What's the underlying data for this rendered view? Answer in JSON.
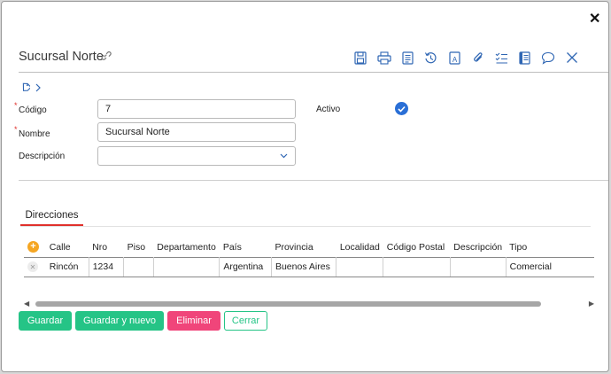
{
  "header": {
    "title": "Sucursal Norte"
  },
  "colors": {
    "accent": "#2f66b3",
    "primary_button": "#25c486",
    "danger_button": "#f0457a",
    "tab_underline": "#e0302b"
  },
  "toolbar_icons": [
    "save-icon",
    "print-icon",
    "document-icon",
    "history-icon",
    "translate-icon",
    "attachment-icon",
    "checklist-icon",
    "notes-icon",
    "comment-icon",
    "close-icon"
  ],
  "form": {
    "codigo": {
      "label": "Código",
      "value": "7"
    },
    "nombre": {
      "label": "Nombre",
      "value": "Sucursal Norte"
    },
    "descripcion": {
      "label": "Descripción",
      "value": ""
    },
    "activo": {
      "label": "Activo",
      "checked": true
    }
  },
  "tabs": [
    {
      "label": "Direcciones"
    }
  ],
  "table": {
    "columns": [
      "Calle",
      "Nro",
      "Piso",
      "Departamento",
      "País",
      "Provincia",
      "Localidad",
      "Código Postal",
      "Descripción",
      "Tipo"
    ],
    "rows": [
      {
        "calle": "Rincón",
        "nro": "1234",
        "piso": "",
        "departamento": "",
        "pais": "Argentina",
        "provincia": "Buenos Aires",
        "localidad": "",
        "codigo_postal": "",
        "descripcion": "",
        "tipo": "Comercial"
      }
    ]
  },
  "buttons": {
    "save": "Guardar",
    "save_new": "Guardar y nuevo",
    "delete": "Eliminar",
    "close": "Cerrar"
  }
}
